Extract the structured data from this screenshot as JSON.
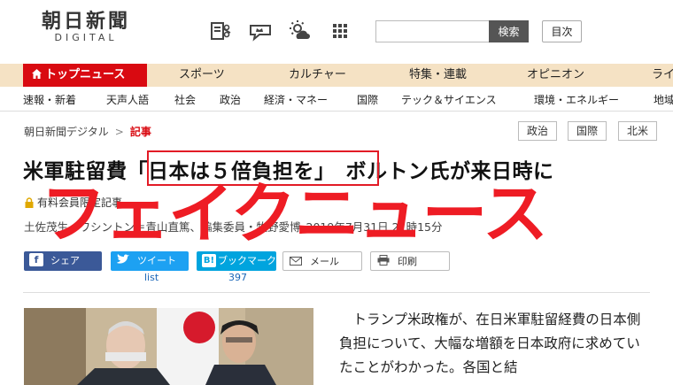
{
  "header": {
    "logo_jp": "朝日新聞",
    "logo_en": "DIGITAL",
    "icons": [
      "newspaper-scissors-icon",
      "crown-chat-icon",
      "weather-icon",
      "menu-grid-icon"
    ],
    "search_placeholder": "",
    "search_button": "検索",
    "index_button": "目次"
  },
  "nav_primary": {
    "active": "トップニュース",
    "items": [
      "スポーツ",
      "カルチャー",
      "特集・連載",
      "オピニオン",
      "ライ"
    ]
  },
  "nav_secondary": {
    "items": [
      "速報・新着",
      "天声人語",
      "社会",
      "政治",
      "経済・マネー",
      "国際",
      "テック＆サイエンス",
      "環境・エネルギー",
      "地域"
    ]
  },
  "breadcrumb": {
    "home": "朝日新聞デジタル",
    "separator": ">",
    "current": "記事"
  },
  "tags": [
    "政治",
    "国際",
    "北米"
  ],
  "article": {
    "headline": "米軍駐留費「日本は５倍負担を」　ボルトン氏が来日時に",
    "premium_label": "有料会員限定記事",
    "byline": "土佐茂生、ワシントン＝青山直篤、編集委員・牧野愛博",
    "timestamp": "2019年7月31日 21時15分",
    "body": "トランプ米政権が、在日米軍駐留経費の日本側負担について、大幅な増額を日本政府に求めていたことがわかった。各国と結"
  },
  "share": {
    "facebook": "シェア",
    "twitter": "ツイート",
    "twitter_count": "list",
    "hatena": "ブックマーク",
    "hatena_count": "397",
    "mail": "メール",
    "print": "印刷"
  },
  "overlay": {
    "text": "フェイクニュース",
    "color": "#ee1c24"
  },
  "colors": {
    "brand_red": "#d90a11",
    "nav_bg": "#f5e2c4",
    "facebook": "#3b5998",
    "twitter": "#1da1f2",
    "hatena": "#00a4de"
  }
}
